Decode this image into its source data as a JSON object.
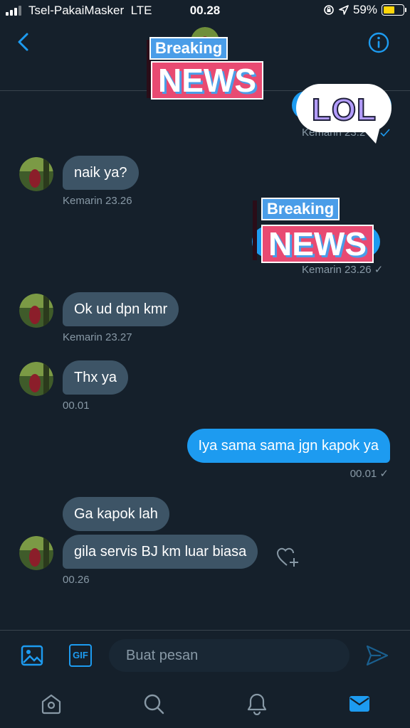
{
  "status_bar": {
    "carrier": "Tsel-PakaiMasker",
    "network": "LTE",
    "time": "00.28",
    "battery": "59%",
    "battery_level": 0.59
  },
  "header": {
    "back_icon": "chevron-left-icon",
    "info_icon": "info-icon"
  },
  "stickers": {
    "breaking_top": "Breaking",
    "breaking_main": "NEWS",
    "lol": "LOL"
  },
  "messages": [
    {
      "id": "m0",
      "meta": "Kemarin 23.2",
      "direction": "out"
    },
    {
      "id": "m1",
      "text": "naik ya?",
      "meta": "Kemarin 23.26",
      "direction": "in"
    },
    {
      "id": "m2",
      "meta": "Kemarin 23.26 ✓",
      "direction": "out"
    },
    {
      "id": "m3",
      "text": "Ok ud dpn kmr",
      "meta": "Kemarin 23.27",
      "direction": "in"
    },
    {
      "id": "m4",
      "text": "Thx ya",
      "meta": "00.01",
      "direction": "in"
    },
    {
      "id": "m5",
      "text": "Iya sama sama jgn kapok ya",
      "meta": "00.01 ✓",
      "direction": "out"
    },
    {
      "id": "m6",
      "text": "Ga kapok lah",
      "direction": "in"
    },
    {
      "id": "m7",
      "text": "gila servis BJ km luar biasa",
      "meta": "00.26",
      "direction": "in"
    }
  ],
  "composer": {
    "placeholder": "Buat pesan",
    "gif_label": "GIF"
  },
  "colors": {
    "background": "#15202b",
    "incoming_bubble": "#3d5466",
    "outgoing_bubble": "#1d9bf0",
    "accent": "#1d9bf0",
    "meta_text": "#8899a6"
  }
}
